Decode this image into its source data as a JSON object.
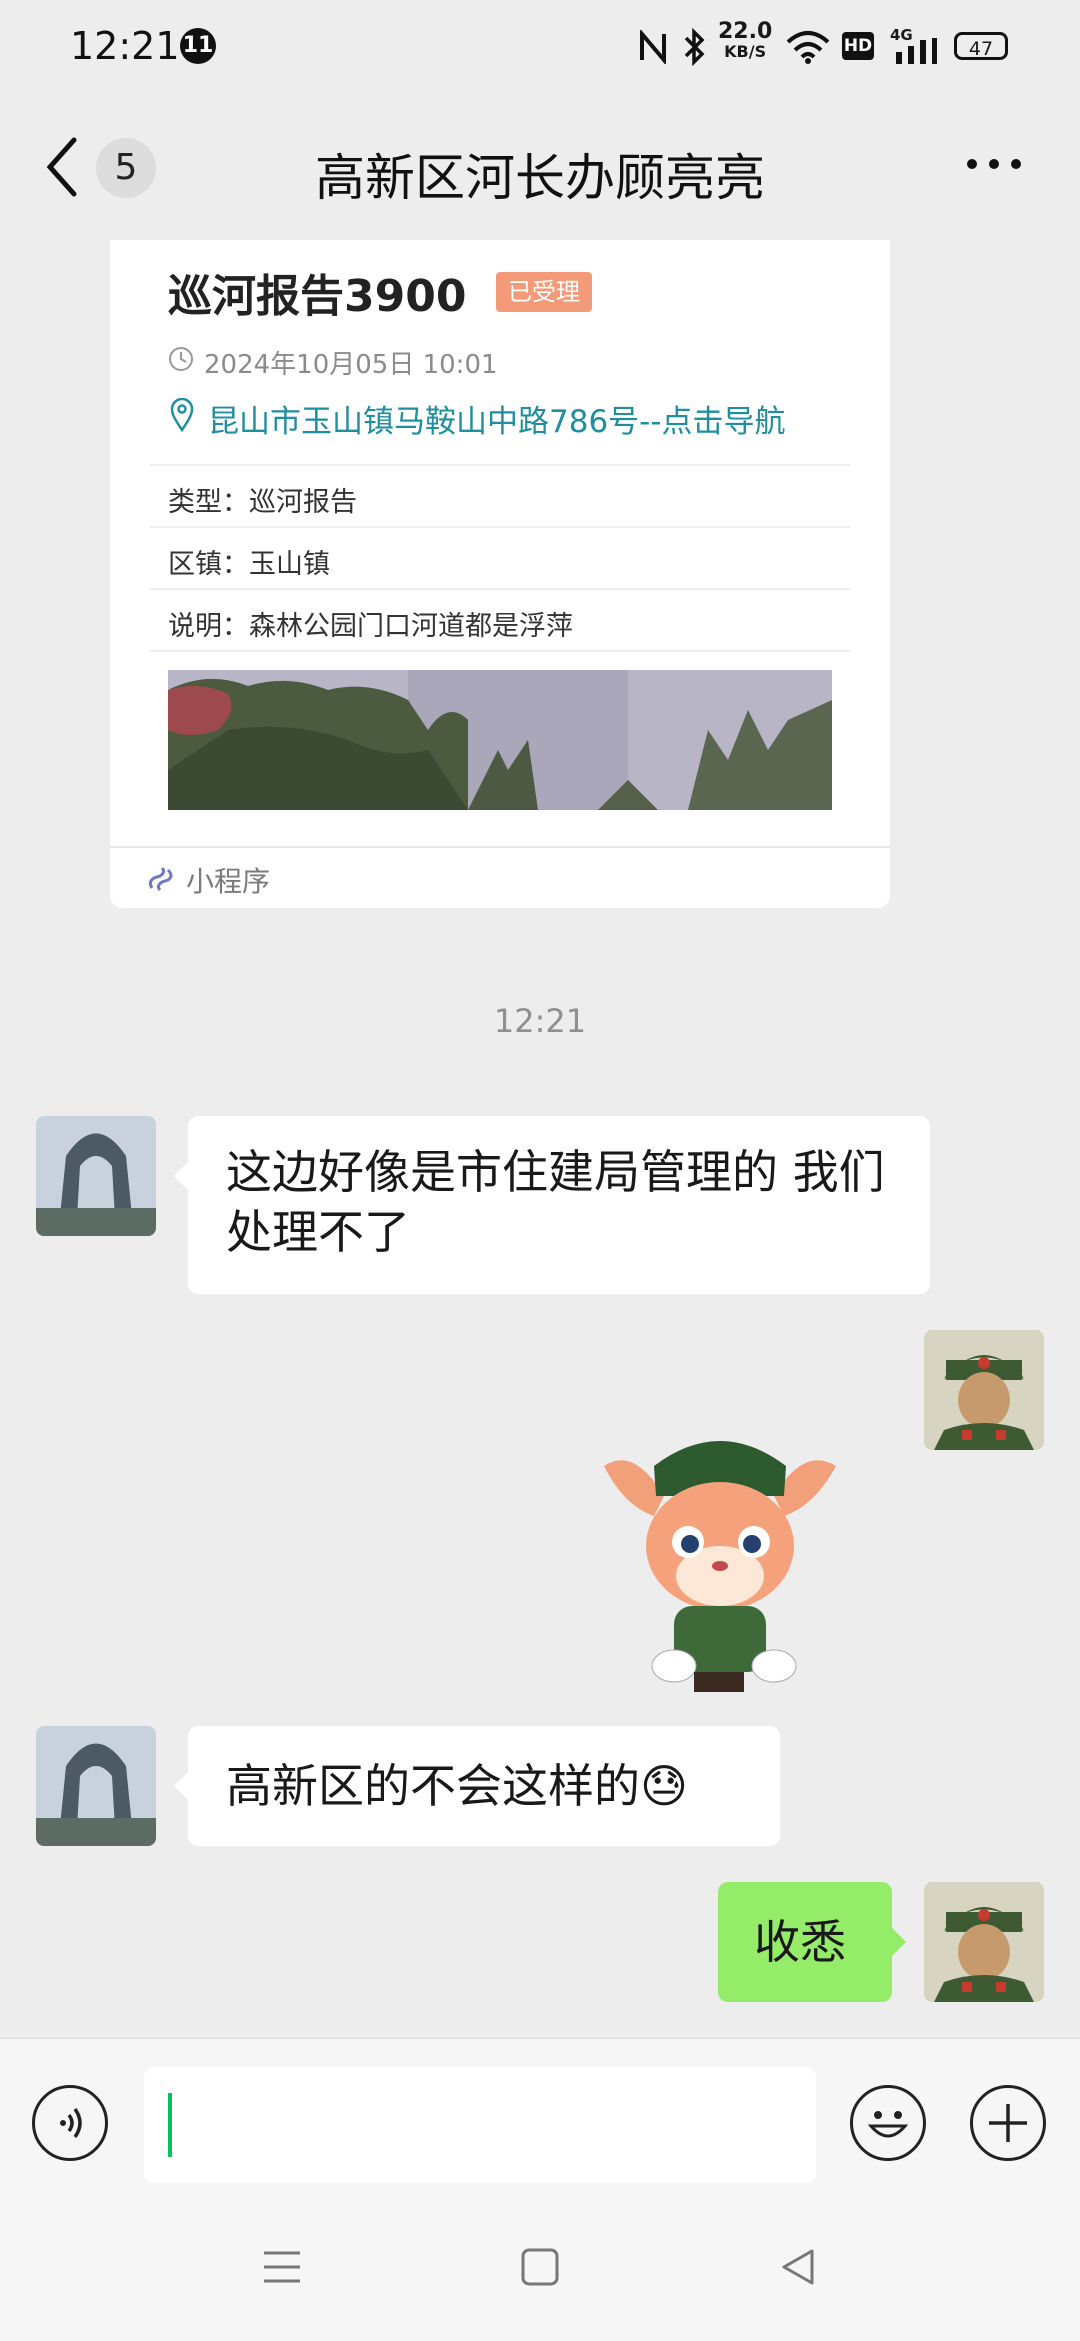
{
  "status_bar": {
    "time": "12:21",
    "notification_count": "11",
    "net_speed_value": "22.0",
    "net_speed_unit": "KB/S",
    "hd_label": "HD",
    "network_type": "4G",
    "battery": "47"
  },
  "nav": {
    "unread_count": "5",
    "title": "高新区河长办顾亮亮"
  },
  "card": {
    "title": "巡河报告3900",
    "status": "已受理",
    "datetime": "2024年10月05日 10:01",
    "location": "昆山市玉山镇马鞍山中路786号--点击导航",
    "rows": [
      {
        "text": "类型：巡河报告"
      },
      {
        "text": "区镇：玉山镇"
      },
      {
        "text": "说明：森林公园门口河道都是浮萍"
      }
    ],
    "footer_label": "小程序"
  },
  "timestamp": "12:21",
  "messages": [
    {
      "side": "left",
      "text": "这边好像是市住建局管理的 我们处理不了"
    },
    {
      "side": "right",
      "type": "sticker"
    },
    {
      "side": "left",
      "text": "高新区的不会这样的😓"
    },
    {
      "side": "right",
      "text": "收悉"
    }
  ],
  "colors": {
    "accent_green": "#95ec69",
    "link_teal": "#1f8fa0",
    "status_badge": "#f39b78",
    "background": "#ededed"
  }
}
